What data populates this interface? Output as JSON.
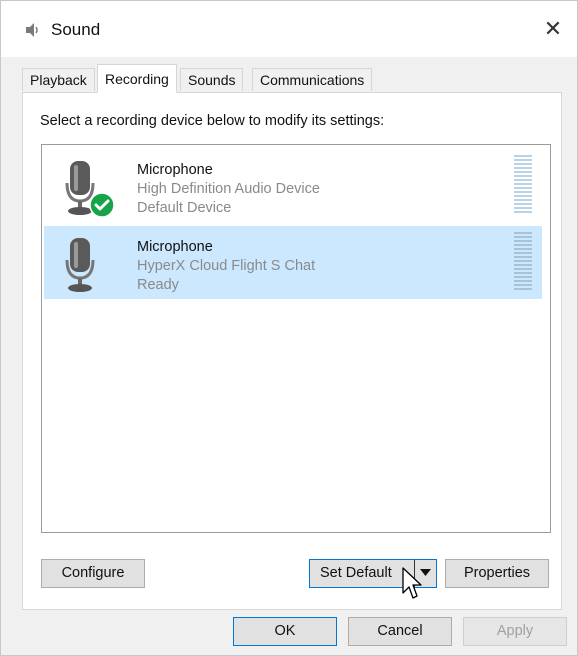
{
  "window": {
    "title": "Sound"
  },
  "tabs": [
    {
      "label": "Playback",
      "active": false
    },
    {
      "label": "Recording",
      "active": true
    },
    {
      "label": "Sounds",
      "active": false
    },
    {
      "label": "Communications",
      "active": false
    }
  ],
  "panel": {
    "instruction": "Select a recording device below to modify its settings:"
  },
  "devices": [
    {
      "name": "Microphone",
      "description": "High Definition Audio Device",
      "status": "Default Device",
      "selected": false,
      "is_default": true,
      "icon": "microphone-icon"
    },
    {
      "name": "Microphone",
      "description": "HyperX Cloud Flight S Chat",
      "status": "Ready",
      "selected": true,
      "is_default": false,
      "icon": "microphone-icon"
    }
  ],
  "buttons": {
    "configure": "Configure",
    "set_default": "Set Default",
    "properties": "Properties",
    "ok": "OK",
    "cancel": "Cancel",
    "apply": "Apply"
  },
  "colors": {
    "selection": "#cce8ff",
    "default_check": "#16a34a",
    "focus_border": "#0078d7"
  }
}
